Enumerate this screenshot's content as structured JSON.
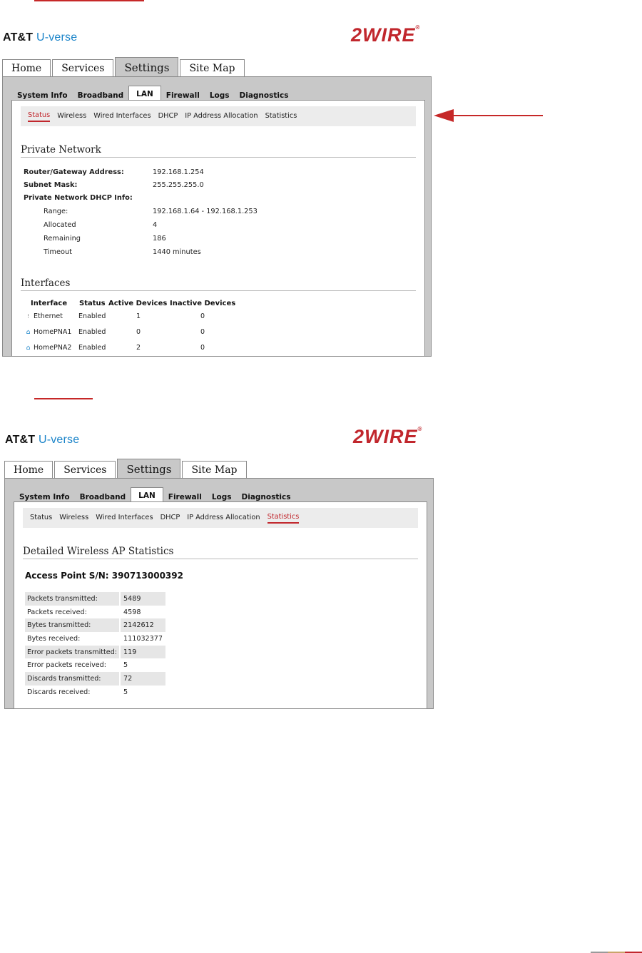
{
  "colors": {
    "accent": "#c1272d",
    "uverse_blue": "#1b84c9",
    "frame_gray": "#c8c8c8"
  },
  "brand": {
    "att": "AT&T",
    "uverse": "U-verse",
    "logo": "2WIRE",
    "logo_mark": "®"
  },
  "main_tabs": [
    "Home",
    "Services",
    "Settings",
    "Site Map"
  ],
  "sub_tabs": [
    "System Info",
    "Broadband",
    "LAN",
    "Firewall",
    "Logs",
    "Diagnostics"
  ],
  "lan_nav": [
    "Status",
    "Wireless",
    "Wired Interfaces",
    "DHCP",
    "IP Address Allocation",
    "Statistics"
  ],
  "status_page": {
    "section_title": "Private Network",
    "router_label": "Router/Gateway Address:",
    "router_value": "192.168.1.254",
    "mask_label": "Subnet Mask:",
    "mask_value": "255.255.255.0",
    "dhcp_label": "Private Network DHCP Info:",
    "range_label": "Range:",
    "range_value": "192.168.1.64 - 192.168.1.253",
    "allocated_label": "Allocated",
    "allocated_value": "4",
    "remaining_label": "Remaining",
    "remaining_value": "186",
    "timeout_label": "Timeout",
    "timeout_value": "1440 minutes",
    "interfaces_title": "Interfaces",
    "interfaces_headers": [
      "Interface",
      "Status",
      "Active Devices",
      "Inactive Devices"
    ],
    "interfaces": [
      {
        "name": "Ethernet",
        "icon": "ethernet-icon",
        "status": "Enabled",
        "active": "1",
        "inactive": "0"
      },
      {
        "name": "HomePNA1",
        "icon": "homepna-icon",
        "status": "Enabled",
        "active": "0",
        "inactive": "0"
      },
      {
        "name": "HomePNA2",
        "icon": "homepna-icon",
        "status": "Enabled",
        "active": "2",
        "inactive": "0"
      }
    ]
  },
  "stats_page": {
    "section_title": "Detailed Wireless AP Statistics",
    "ap_label": "Access Point S/N:",
    "ap_serial": "390713000392",
    "rows": [
      {
        "label": "Packets transmitted:",
        "value": "5489"
      },
      {
        "label": "Packets received:",
        "value": "4598"
      },
      {
        "label": "Bytes transmitted:",
        "value": "2142612"
      },
      {
        "label": "Bytes received:",
        "value": "111032377"
      },
      {
        "label": "Error packets transmitted:",
        "value": "119"
      },
      {
        "label": "Error packets received:",
        "value": "5"
      },
      {
        "label": "Discards transmitted:",
        "value": "72"
      },
      {
        "label": "Discards received:",
        "value": "5"
      }
    ]
  }
}
